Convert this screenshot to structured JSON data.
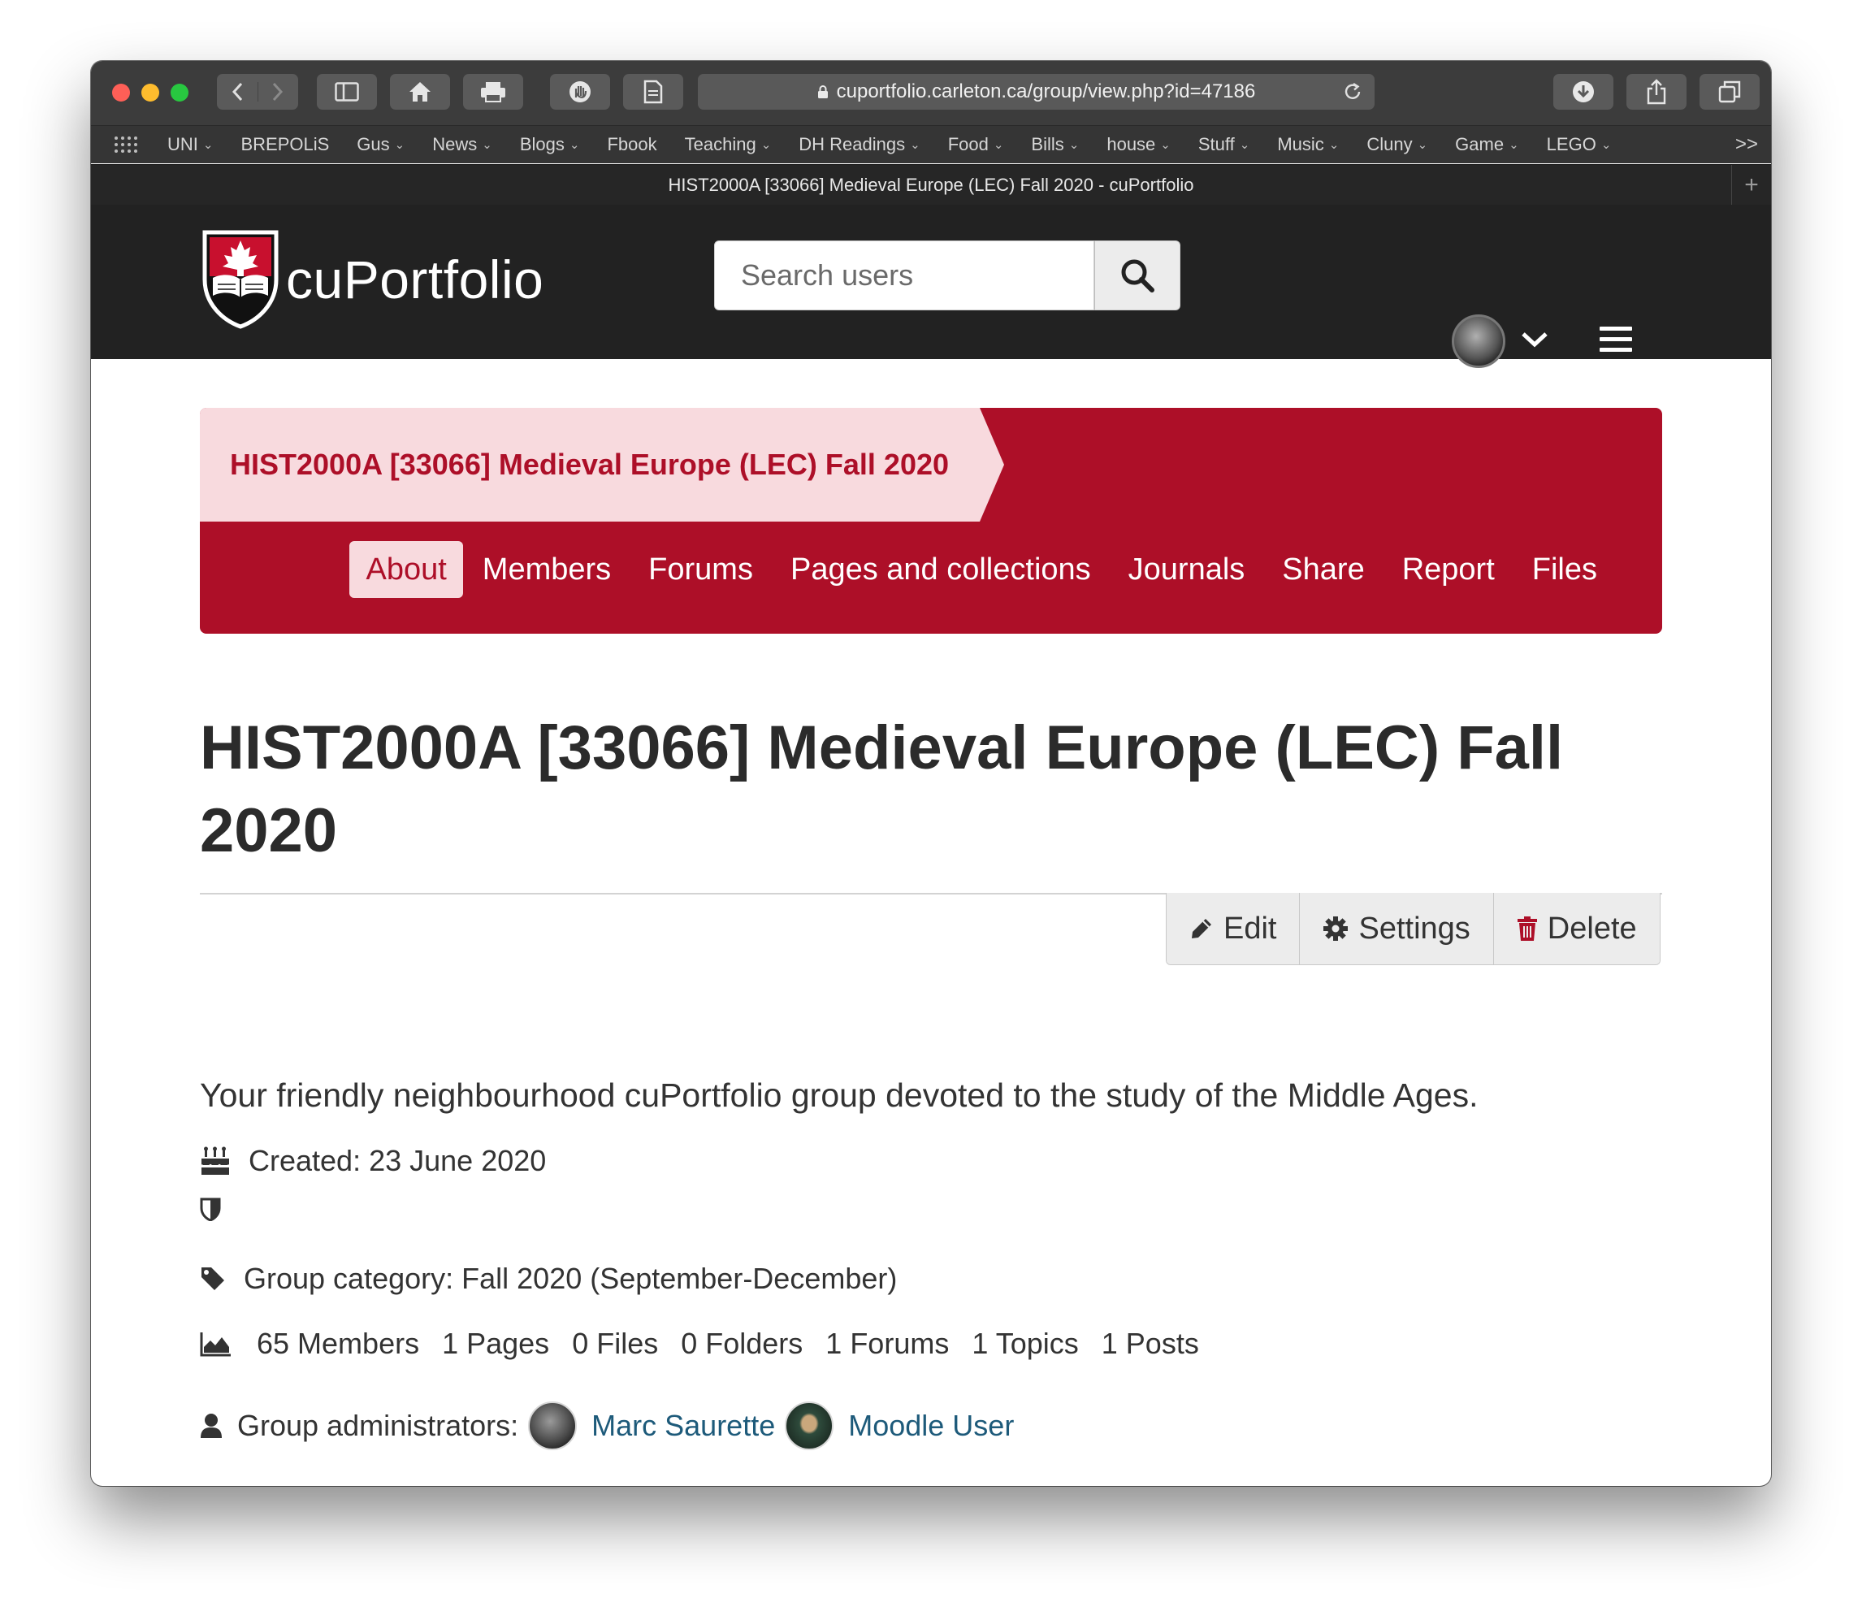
{
  "browser": {
    "url": "cuportfolio.carleton.ca/group/view.php?id=47186",
    "tab_title": "HIST2000A [33066] Medieval Europe (LEC) Fall 2020 - cuPortfolio",
    "bookmarks": [
      {
        "label": "UNI",
        "folder": true
      },
      {
        "label": "BREPOLiS",
        "folder": false
      },
      {
        "label": "Gus",
        "folder": true
      },
      {
        "label": "News",
        "folder": true
      },
      {
        "label": "Blogs",
        "folder": true
      },
      {
        "label": "Fbook",
        "folder": false
      },
      {
        "label": "Teaching",
        "folder": true
      },
      {
        "label": "DH Readings",
        "folder": true
      },
      {
        "label": "Food",
        "folder": true
      },
      {
        "label": "Bills",
        "folder": true
      },
      {
        "label": "house",
        "folder": true
      },
      {
        "label": "Stuff",
        "folder": true
      },
      {
        "label": "Music",
        "folder": true
      },
      {
        "label": "Cluny",
        "folder": true
      },
      {
        "label": "Game",
        "folder": true
      },
      {
        "label": "LEGO",
        "folder": true
      }
    ],
    "more_bookmarks": ">>"
  },
  "header": {
    "logo_text": "cuPortfolio",
    "search_placeholder": "Search users",
    "colors": {
      "bg": "#222222"
    }
  },
  "group": {
    "banner_title": "HIST2000A [33066] Medieval Europe (LEC) Fall 2020",
    "nav": [
      "About",
      "Members",
      "Forums",
      "Pages and collections",
      "Journals",
      "Share",
      "Report",
      "Files"
    ],
    "active_nav": "About",
    "title": "HIST2000A [33066] Medieval Europe (LEC) Fall 2020",
    "actions": {
      "edit": "Edit",
      "settings": "Settings",
      "delete": "Delete"
    },
    "description": "Your friendly neighbourhood cuPortfolio group devoted to the study of the Middle Ages.",
    "created": "Created: 23 June 2020",
    "category": "Group category: Fall 2020 (September-December)",
    "stats": [
      "65 Members",
      "1 Pages",
      "0 Files",
      "0 Folders",
      "1 Forums",
      "1 Topics",
      "1 Posts"
    ],
    "admins_label": "Group administrators:",
    "admins": [
      "Marc Saurette",
      "Moodle User"
    ],
    "colors": {
      "brand_red": "#ad0f28",
      "tab_pink": "#f8dade",
      "link": "#1d5a7a"
    }
  }
}
